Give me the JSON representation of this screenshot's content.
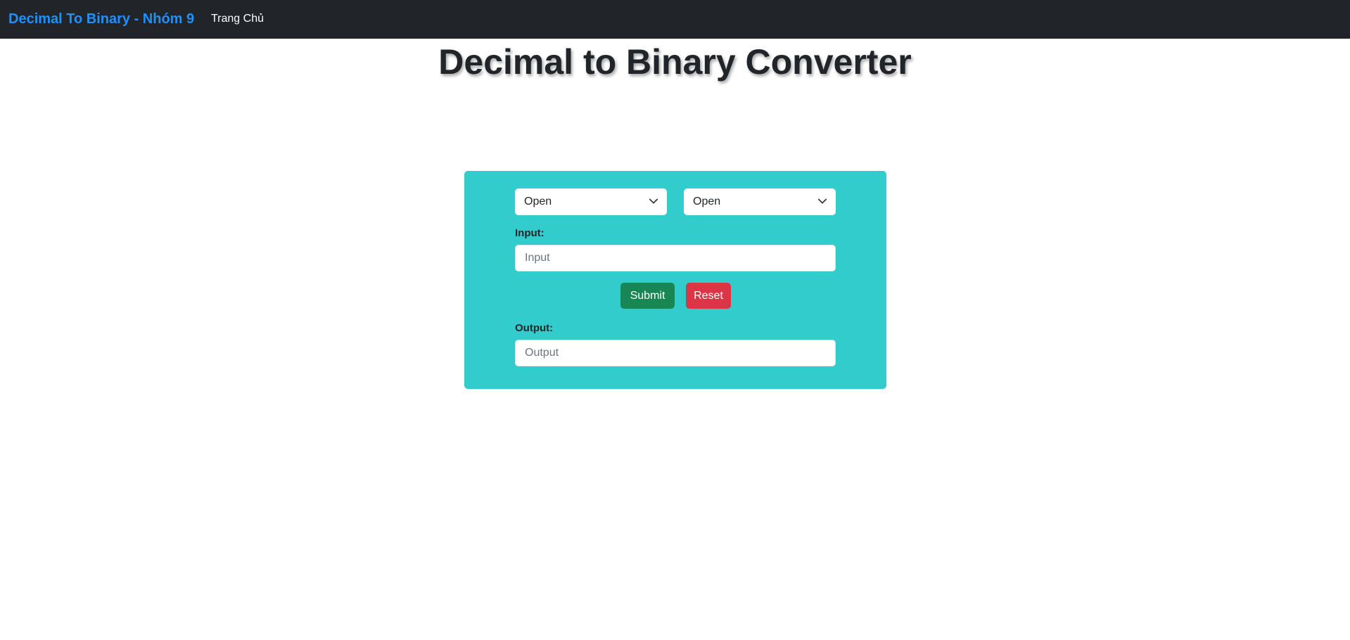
{
  "navbar": {
    "brand": "Decimal To Binary - Nhóm 9",
    "links": [
      {
        "label": "Trang Chủ"
      }
    ]
  },
  "page": {
    "title": "Decimal to Binary Converter"
  },
  "converter": {
    "from_select": {
      "selected": "Open",
      "icon": "chevron-down-icon"
    },
    "to_select": {
      "selected": "Open",
      "icon": "chevron-down-icon"
    },
    "input_label": "Input:",
    "input_placeholder": "Input",
    "input_value": "",
    "submit_label": "Submit",
    "reset_label": "Reset",
    "output_label": "Output:",
    "output_placeholder": "Output",
    "output_value": ""
  },
  "colors": {
    "navbar_bg": "#212529",
    "brand": "#1e90ff",
    "card_bg": "#33cccc",
    "submit": "#198754",
    "reset": "#dc3545"
  }
}
